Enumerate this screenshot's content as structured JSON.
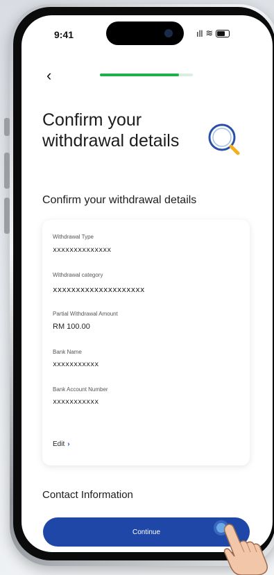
{
  "status_bar": {
    "time": "9:41",
    "signal": "ıll",
    "wifi": "≋"
  },
  "nav": {
    "back_icon": "‹",
    "progress": 0.85
  },
  "page": {
    "title": "Confirm your withdrawal details"
  },
  "section": {
    "heading": "Confirm your withdrawal details"
  },
  "details": {
    "withdrawal_type_label": "Withdrawal Type",
    "withdrawal_type_value": "xxxxxxxxxxxxxx",
    "withdrawal_category_label": "Withdrawal category",
    "withdrawal_category_value": "xxxxxxxxxxxxxxxxxxxx",
    "amount_label": "Partial Withdrawal Amount",
    "amount_value": "RM 100.00",
    "bank_name_label": "Bank Name",
    "bank_name_value": "xxxxxxxxxxx",
    "bank_account_label": "Bank Account Number",
    "bank_account_value": "xxxxxxxxxxx",
    "edit_label": "Edit",
    "edit_icon": "›"
  },
  "contact": {
    "heading": "Contact Information"
  },
  "footer": {
    "continue_label": "Continue"
  },
  "colors": {
    "primary": "#1f47a8",
    "progress": "#1fb04a",
    "accent": "#1d4fb8"
  }
}
